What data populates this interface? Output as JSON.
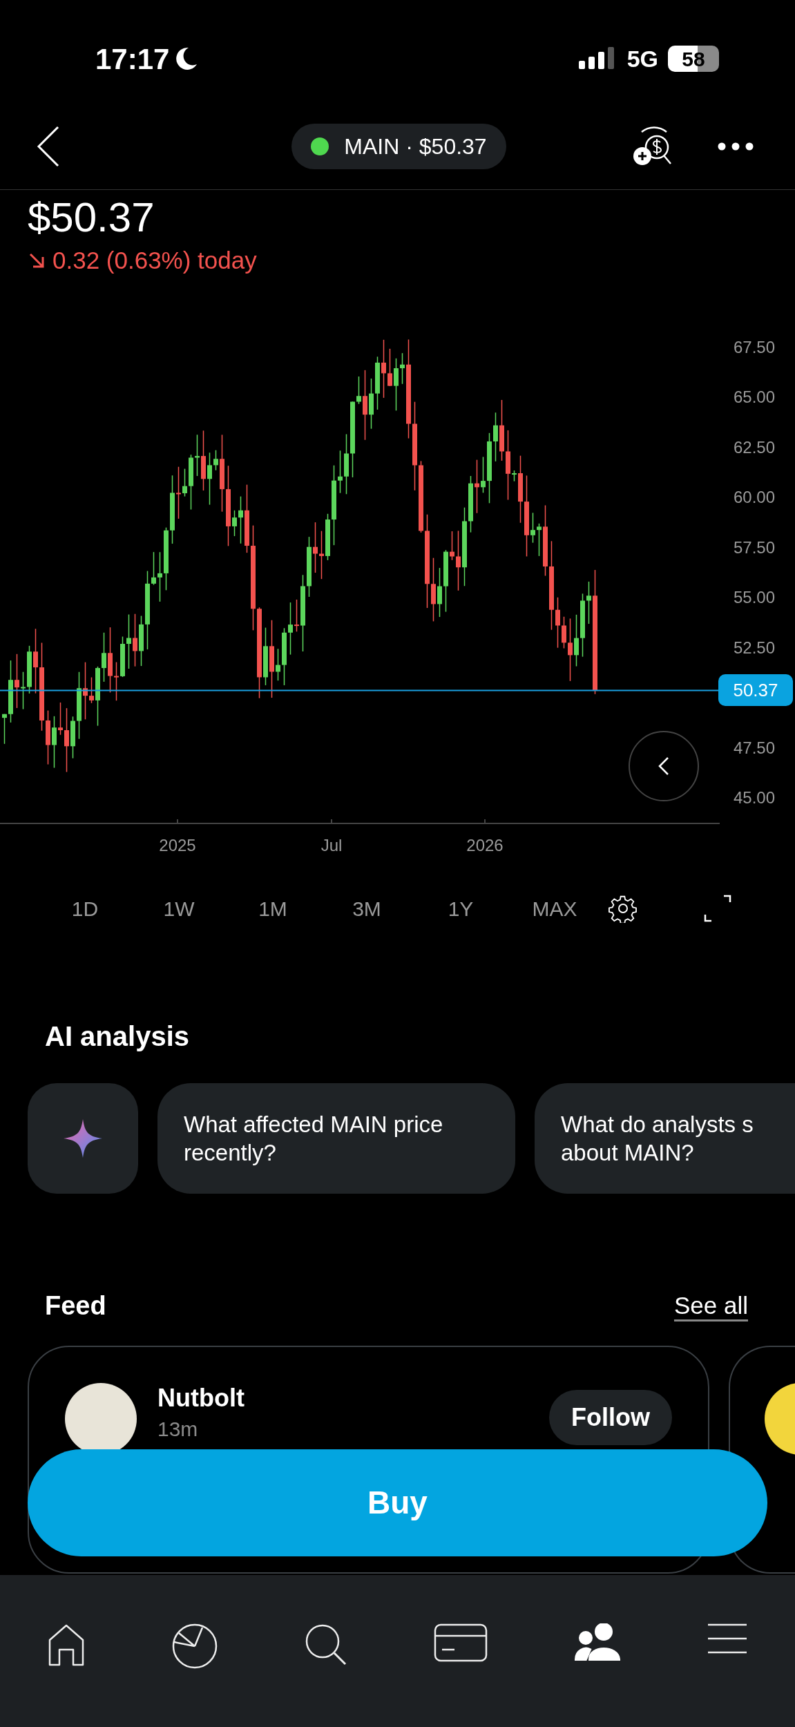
{
  "status_bar": {
    "time": "17:17",
    "network": "5G",
    "battery": "58"
  },
  "header": {
    "ticker_pill": "MAIN · $50.37",
    "live": true
  },
  "quote": {
    "price": "$50.37",
    "change": "0.32 (0.63%) today"
  },
  "chart": {
    "y_labels": [
      "67.50",
      "65.00",
      "62.50",
      "60.00",
      "57.50",
      "55.00",
      "52.50",
      "47.50",
      "45.00"
    ],
    "x_labels": [
      "2025",
      "Jul",
      "2026"
    ],
    "price_tag": "50.37"
  },
  "ranges": [
    {
      "label": "1D",
      "selected": false
    },
    {
      "label": "1W",
      "selected": false
    },
    {
      "label": "1M",
      "selected": false
    },
    {
      "label": "3M",
      "selected": false
    },
    {
      "label": "1Y",
      "selected": false
    },
    {
      "label": "MAX",
      "selected": false
    }
  ],
  "ai_analysis": {
    "title": "AI analysis",
    "prompts": [
      "What affected MAIN price recently?",
      "What do analysts s about MAIN?"
    ]
  },
  "feed": {
    "title": "Feed",
    "see_all": "See all",
    "posts": [
      {
        "author": "Nutbolt",
        "time": "13m",
        "follow": "Follow"
      }
    ]
  },
  "buy_button": "Buy",
  "nav": [
    {
      "kind": "home",
      "selected": false
    },
    {
      "kind": "portfolio",
      "selected": false
    },
    {
      "kind": "search",
      "selected": false
    },
    {
      "kind": "card",
      "selected": false
    },
    {
      "kind": "community",
      "selected": true
    },
    {
      "kind": "menu",
      "selected": false
    }
  ]
}
